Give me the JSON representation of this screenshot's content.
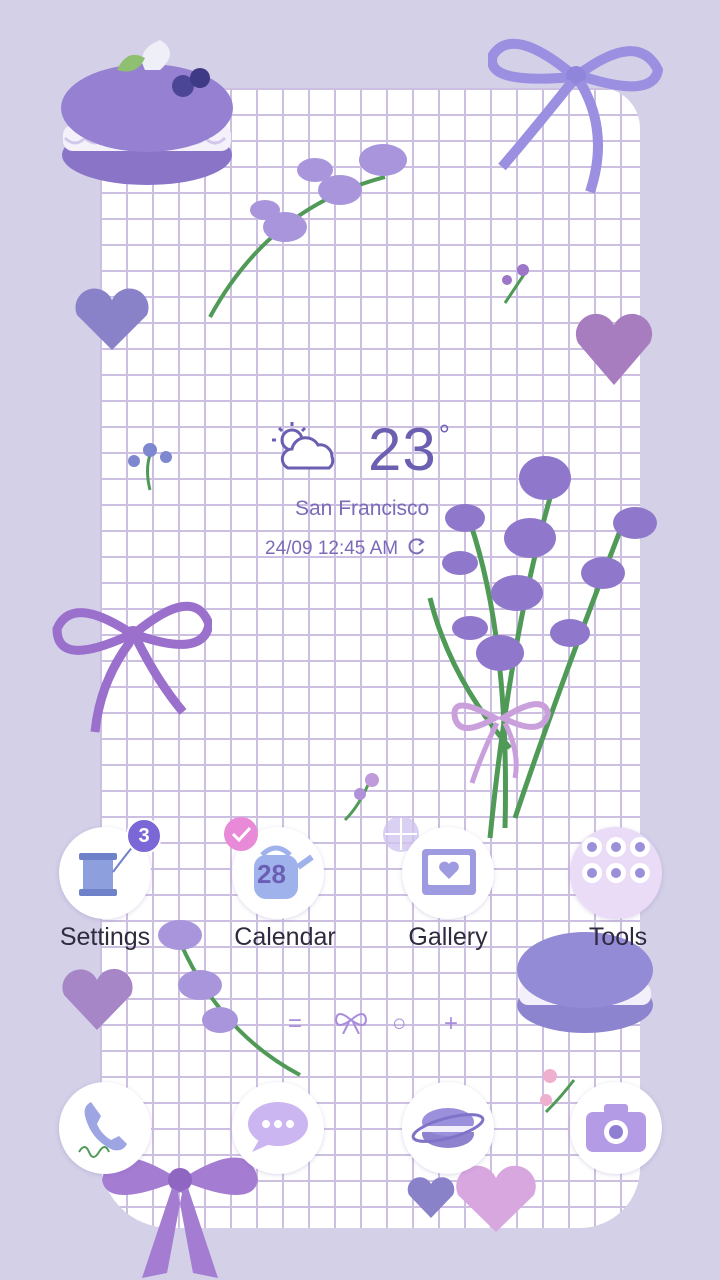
{
  "theme": {
    "accent": "#7b67d6",
    "background": "#d3d0e8",
    "text_color": "#2f2a3d"
  },
  "weather": {
    "icon": "partly-cloudy-icon",
    "temperature": "23",
    "unit": "°",
    "city": "San Francisco",
    "datetime": "24/09 12:45 AM",
    "refresh_icon": "refresh-icon"
  },
  "apps": [
    {
      "label": "Settings",
      "icon": "thread-spool-icon",
      "badge": "3"
    },
    {
      "label": "Calendar",
      "icon": "watering-can-calendar-icon",
      "day": "28"
    },
    {
      "label": "Gallery",
      "icon": "photo-heart-icon"
    },
    {
      "label": "Tools",
      "icon": "tools-folder-icon"
    }
  ],
  "page_indicators": [
    "=",
    "bow",
    "○",
    "+"
  ],
  "dock": [
    {
      "icon": "phone-icon"
    },
    {
      "icon": "messages-icon"
    },
    {
      "icon": "planet-macaron-icon"
    },
    {
      "icon": "camera-icon"
    }
  ]
}
